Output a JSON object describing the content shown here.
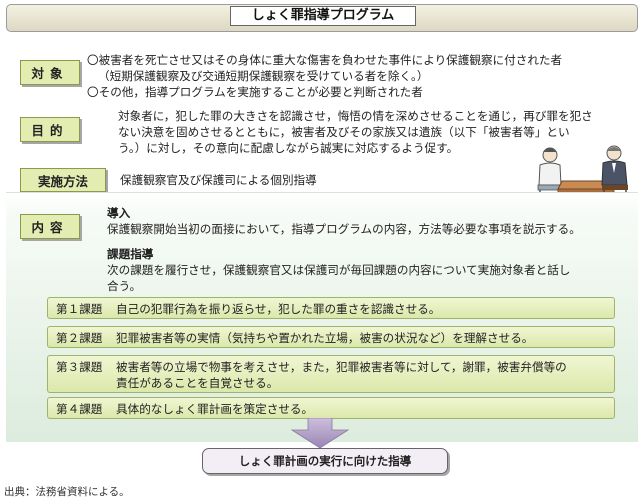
{
  "title": "しょく罪指導プログラム",
  "sections": {
    "target": {
      "label": "対象",
      "lines": [
        "〇被害者を死亡させ又はその身体に重大な傷害を負わせた事件により保護観察に付された者",
        "（短期保護観察及び交通短期保護観察を受けている者を除く。）",
        "〇その他，指導プログラムを実施することが必要と判断された者"
      ]
    },
    "purpose": {
      "label": "目的",
      "lines": [
        "対象者に，犯した罪の大きさを認識させ，悔悟の情を深めさせることを通じ，再び罪を犯さ",
        "ない決意を固めさせるとともに，被害者及びその家族又は遺族（以下「被害者等」とい",
        "う。）に対し，その意向に配慮しながら誠実に対応するよう促す。"
      ]
    },
    "method": {
      "label": "実施方法",
      "text": "保護観察官及び保護司による個別指導"
    },
    "content": {
      "label": "内容",
      "intro_head": "導入",
      "intro_text": "保護観察開始当初の面接において，指導プログラムの内容，方法等必要な事項を説示する。",
      "tasks_head": "課題指導",
      "tasks_lines": [
        "次の課題を履行させ，保護観察官又は保護司が毎回課題の内容について実施対象者と話し",
        "合う。"
      ],
      "tasks": [
        {
          "num": "第１課題",
          "lines": [
            "自己の犯罪行為を振り返らせ，犯した罪の重さを認識させる。"
          ]
        },
        {
          "num": "第２課題",
          "lines": [
            "犯罪被害者等の実情（気持ちや置かれた立場，被害の状況など）を理解させる。"
          ]
        },
        {
          "num": "第３課題",
          "lines": [
            "被害者等の立場で物事を考えさせ，また，犯罪被害者等に対して，謝罪，被害弁償等の",
            "責任があることを自覚させる。"
          ]
        },
        {
          "num": "第４課題",
          "lines": [
            "具体的なしょく罪計画を策定させる。"
          ]
        }
      ]
    }
  },
  "result": "しょく罪計画の実行に向けた指導",
  "source": "出典：法務省資料による。"
}
